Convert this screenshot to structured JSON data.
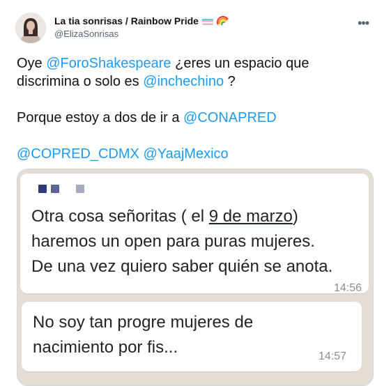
{
  "tweet": {
    "display_name": "La tia sonrisas / Rainbow Pride",
    "handle": "@ElizaSonrisas",
    "more_label": "•••",
    "text": {
      "line1_prefix": "Oye ",
      "mention1": "@ForoShakespeare",
      "line1_suffix": " ¿eres un espacio que discrimina o solo es ",
      "mention2": "@inchechino",
      "line1_end": " ?",
      "line2_prefix": "Porque estoy a dos de ir a ",
      "mention3": "@CONAPRED",
      "mention4": "@COPRED_CDMX",
      "mention5": "@YaajMexico"
    },
    "colors": {
      "mention": "#1d9bf0",
      "text": "#0f1419",
      "secondary": "#536471",
      "chat_background": "#e5ddd4"
    },
    "icons": [
      "transgender-flag-icon",
      "rainbow-icon",
      "more-icon"
    ]
  },
  "media": {
    "message1": {
      "line1_prefix": "Otra cosa señoritas ( el ",
      "date": "9 de marzo",
      "line1_suffix": ")",
      "line2": "haremos un open para puras mujeres.",
      "line3": "De una vez quiero saber quién se anota.",
      "time": "14:56"
    },
    "message2": {
      "line1": "No soy tan progre mujeres de",
      "line2": "nacimiento por fis...",
      "time": "14:57"
    }
  }
}
